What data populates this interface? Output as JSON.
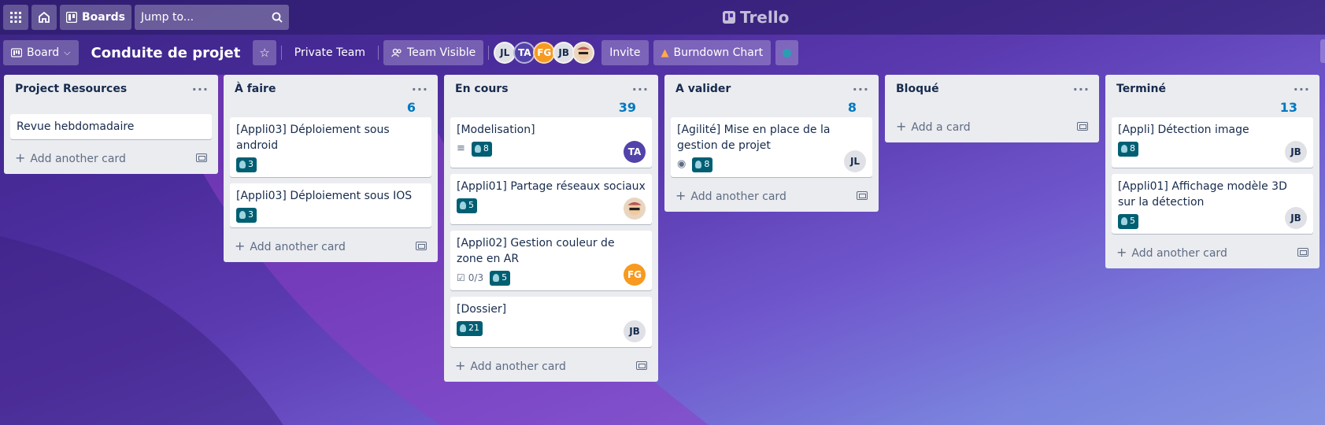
{
  "topbar": {
    "boards_label": "Boards",
    "search_placeholder": "Jump to...",
    "logo_text": "Trello"
  },
  "boardbar": {
    "view_label": "Board",
    "title": "Conduite de projet",
    "team_label": "Private Team",
    "visibility_label": "Team Visible",
    "members": [
      "JL",
      "TA",
      "FG",
      "JB"
    ],
    "invite_label": "Invite",
    "burndown_label": "Burndown Chart"
  },
  "lists": [
    {
      "title": "Project Resources",
      "count": "",
      "cards": [
        {
          "title": "Revue hebdomadaire"
        }
      ],
      "add_label": "Add another card"
    },
    {
      "title": "À faire",
      "count": "6",
      "cards": [
        {
          "title": "[Appli03] Déploiement sous android",
          "points": "3"
        },
        {
          "title": "[Appli03] Déploiement sous IOS",
          "points": "3"
        }
      ],
      "add_label": "Add another card"
    },
    {
      "title": "En cours",
      "count": "39",
      "cards": [
        {
          "title": "[Modelisation]",
          "points": "8",
          "avatar": "TA"
        },
        {
          "title": "[Appli01] Partage réseaux sociaux",
          "points": "5"
        },
        {
          "title": "[Appli02] Gestion couleur de zone en AR",
          "checklist": "0/3",
          "points": "5",
          "avatar": "FG"
        },
        {
          "title": "[Dossier]",
          "points": "21",
          "avatar": "JB"
        }
      ],
      "add_label": "Add another card"
    },
    {
      "title": "A valider",
      "count": "8",
      "cards": [
        {
          "title": "[Agilité] Mise en place de la gestion de projet",
          "points": "8",
          "avatar": "JL"
        }
      ],
      "add_label": "Add another card"
    },
    {
      "title": "Bloqué",
      "count": "",
      "cards": [],
      "add_label": "Add a card"
    },
    {
      "title": "Terminé",
      "count": "13",
      "cards": [
        {
          "title": "[Appli] Détection image",
          "points": "8",
          "avatar": "JB"
        },
        {
          "title": "[Appli01] Affichage modèle 3D sur la détection",
          "points": "5",
          "avatar": "JB"
        }
      ],
      "add_label": "Add another card"
    }
  ],
  "colors": {
    "points_badge": "#005f73",
    "count_text": "#0079bf",
    "list_bg": "#ebecf0"
  }
}
